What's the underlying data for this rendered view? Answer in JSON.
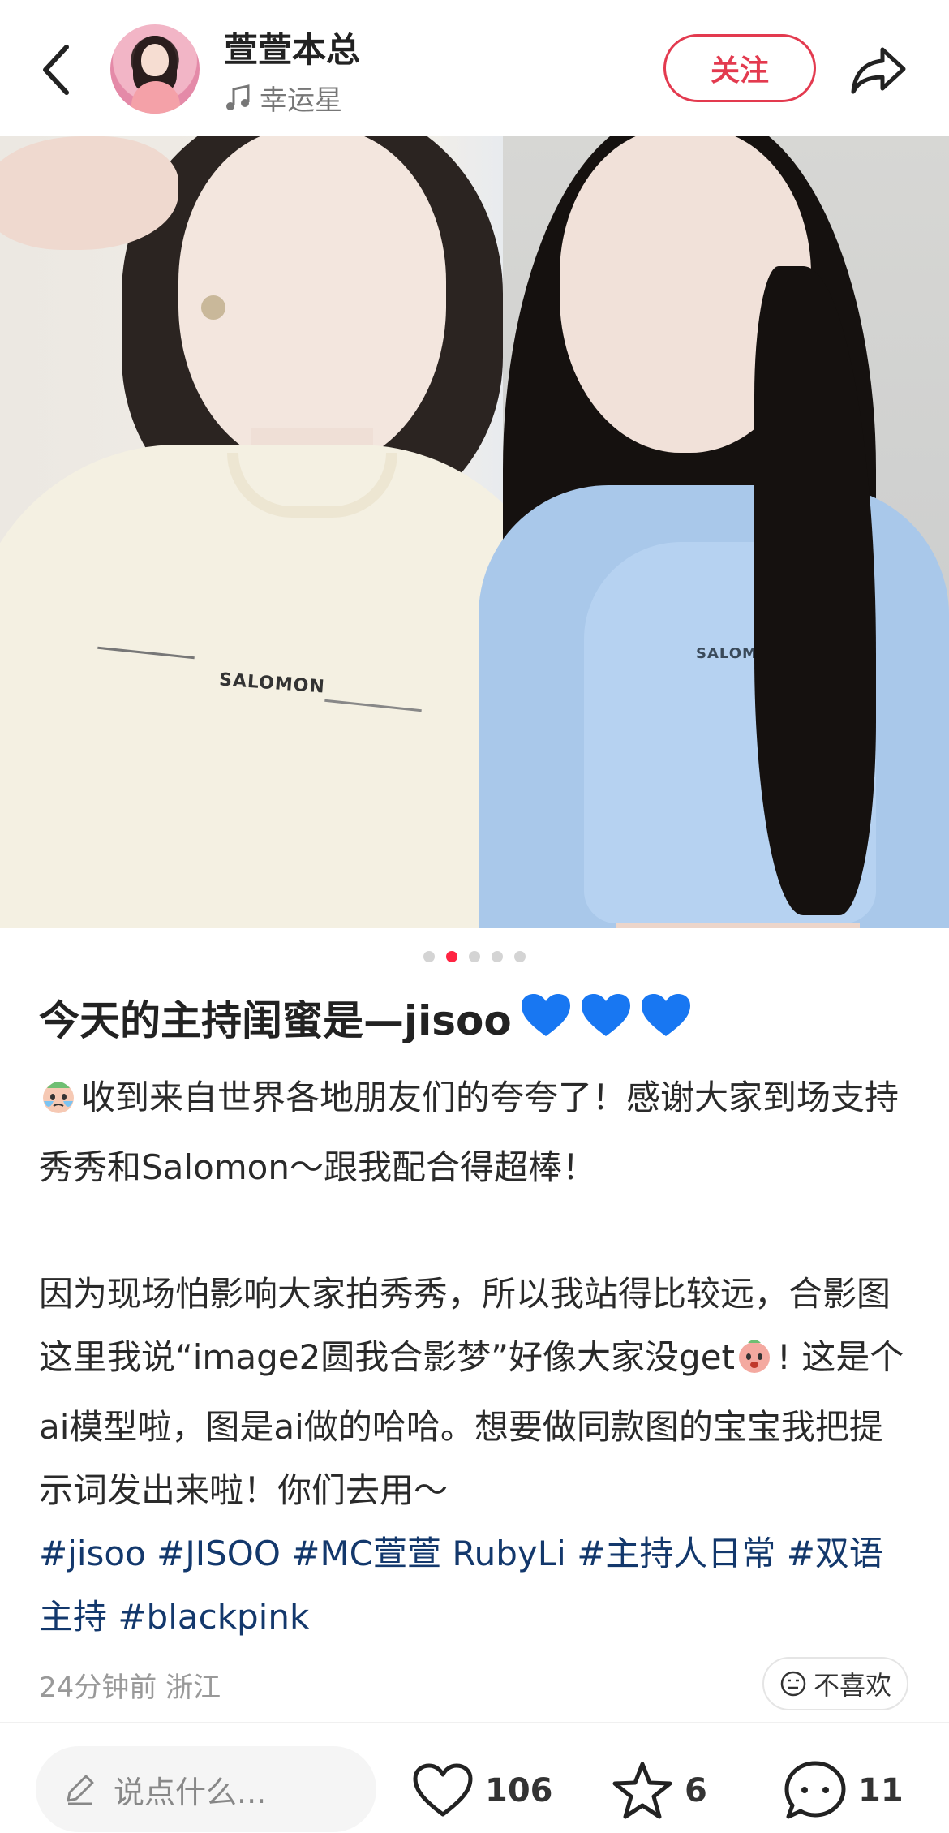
{
  "header": {
    "author_name": "萱萱本总",
    "music_label": "幸运星",
    "follow_label": "关注"
  },
  "carousel": {
    "total": 5,
    "active_index": 1,
    "photo_left_shirt_text": "SALOMON",
    "photo_right_shirt_text": "SALOMON"
  },
  "post": {
    "title": "今天的主持闺蜜是—jisoo",
    "title_emojis": [
      "blue-heart",
      "blue-heart",
      "blue-heart"
    ],
    "paragraph1": "收到来自世界各地朋友们的夸夸了！感谢大家到场支持秀秀和Salomon～跟我配合得超棒！",
    "paragraph2_part1": "因为现场怕影响大家拍秀秀，所以我站得比较远，合影图这里我说“image2圆我合影梦”好像大家没get",
    "paragraph2_part2": "! 这是个ai模型啦，图是ai做的哈哈。想要做同款图的宝宝我把提示词发出来啦！你们去用～",
    "tags": "#jisoo #JISOO #MC萱萱 RubyLi #主持人日常 #双语主持 #blackpink",
    "time_location": "24分钟前 浙江",
    "dislike_label": "不喜欢"
  },
  "bottom_bar": {
    "comment_placeholder": "说点什么...",
    "like_count": "106",
    "collect_count": "6",
    "comment_count": "11"
  },
  "colors": {
    "accent": "#ff2442",
    "follow_border": "#e33a4f",
    "tag_color": "#13386c"
  }
}
